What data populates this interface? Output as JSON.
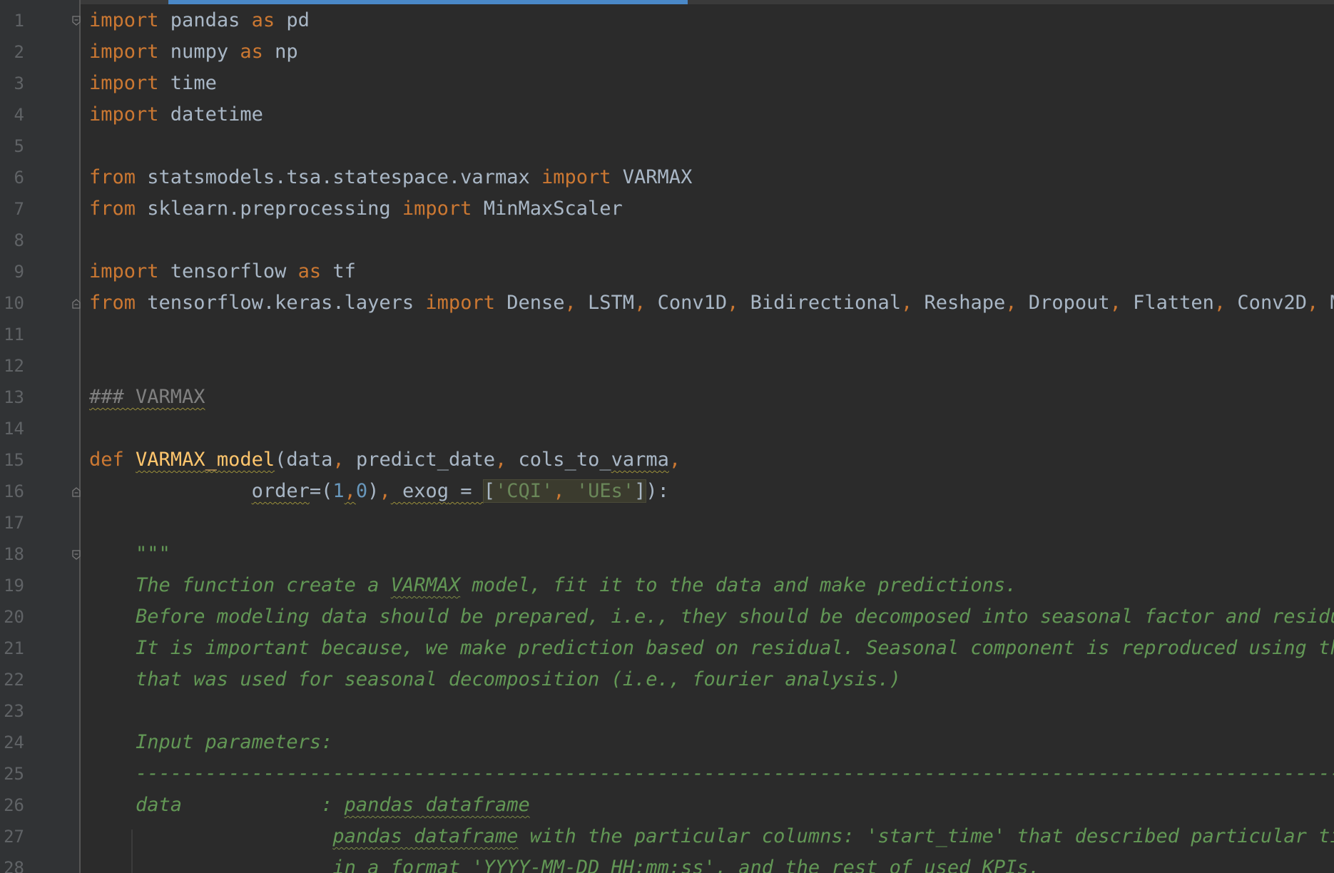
{
  "editor": {
    "line_numbers": [
      "1",
      "2",
      "3",
      "4",
      "5",
      "6",
      "7",
      "8",
      "9",
      "10",
      "11",
      "12",
      "13",
      "14",
      "15",
      "16",
      "17",
      "18",
      "19",
      "20",
      "21",
      "22",
      "23",
      "24",
      "25",
      "26",
      "27",
      "28"
    ]
  },
  "code": {
    "l1": {
      "kw1": "import",
      "mod": " pandas ",
      "kw2": "as",
      "alias": " pd"
    },
    "l2": {
      "kw1": "import",
      "mod": " numpy ",
      "kw2": "as",
      "alias": " np"
    },
    "l3": {
      "kw1": "import",
      "mod": " time"
    },
    "l4": {
      "kw1": "import",
      "mod": " datetime"
    },
    "l6": {
      "kw1": "from",
      "mod": " statsmodels.tsa.statespace.varmax ",
      "kw2": "import",
      "name": " VARMAX"
    },
    "l7": {
      "kw1": "from",
      "mod": " sklearn.preprocessing ",
      "kw2": "import",
      "name": " MinMaxScaler"
    },
    "l9": {
      "kw1": "import",
      "mod": " tensorflow ",
      "kw2": "as",
      "alias": " tf"
    },
    "l10": {
      "kw1": "from",
      "mod": " tensorflow.keras.layers ",
      "kw2": "import",
      "names": [
        " Dense",
        " LSTM",
        " Conv1D",
        " Bidirectional",
        " Reshape",
        " Dropout",
        " Flatten",
        " Conv2D",
        " Ma"
      ],
      "sep": ","
    },
    "l13": {
      "comment": "### VARMAX"
    },
    "l15": {
      "kw": "def",
      "fn": "VARMAX_model",
      "open": "(",
      "p1": "data",
      "c1": ",",
      "p2": " predict_date",
      "c2": ",",
      "p3a": " cols_to_",
      "p3b": "varma",
      "c3": ","
    },
    "l16": {
      "indent": "              ",
      "p4": "order",
      "eq1": "=(",
      "n1": "1",
      "comma": ",",
      "n2": "0",
      "close": ")",
      "c4": ",",
      "p5": " exog",
      "eq2": " = ",
      "sp": " ",
      "lb": "[",
      "s1": "'CQI'",
      "c5": ",",
      "s2": " 'UEs'",
      "rb": "]",
      "end": "):"
    },
    "l18": {
      "q": "    \"\"\""
    },
    "l19": {
      "a": "    The function create a ",
      "b": "VARMAX",
      "c": " model, fit it to the data and make predictions."
    },
    "l20": {
      "text": "    Before modeling data should be prepared, i.e., they should be decomposed into seasonal factor and residua"
    },
    "l21": {
      "text": "    It is important because, we make prediction based on residual. Seasonal component is reproduced using the"
    },
    "l22": {
      "text": "    that was used for seasonal decomposition (i.e., fourier analysis.)"
    },
    "l24": {
      "text": "    Input parameters:"
    },
    "l25": {
      "text": "    ------------------------------------------------------------------------------------------------------------"
    },
    "l26": {
      "a": "    data            : ",
      "b": "pandas dataframe"
    },
    "l27": {
      "indent": "                     ",
      "b": "pandas dataframe",
      "c": " with the particular columns: 'start_time' that described particular tim"
    },
    "l28": {
      "text": "                     in a format 'YYYY-MM-DD HH:mm:ss', and the rest of used KPIs."
    }
  }
}
